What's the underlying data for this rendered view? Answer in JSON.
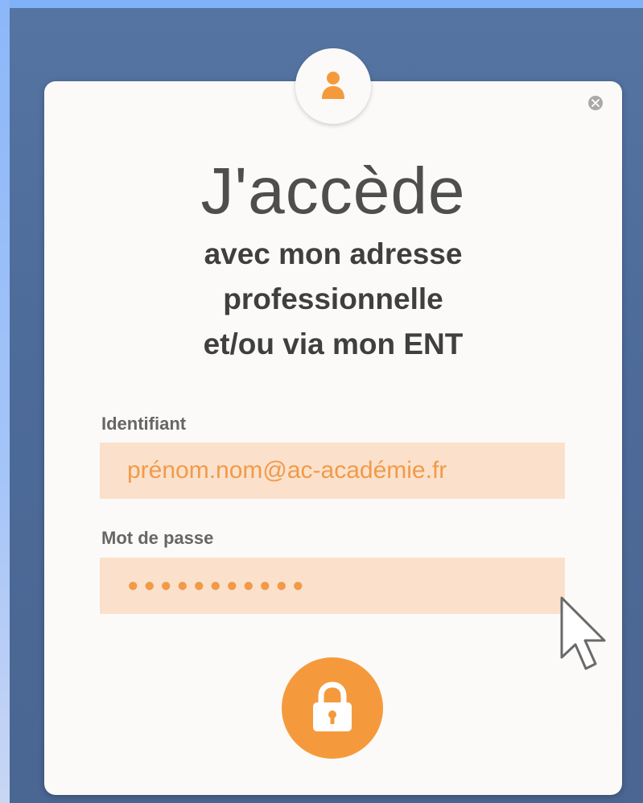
{
  "colors": {
    "accent": "#f59a3c",
    "input_background": "#fbe1cb",
    "input_text": "#f19a4a",
    "card_background": "#fbfaf8",
    "backdrop": "#4d6b99"
  },
  "icons": {
    "avatar": "user-icon",
    "close": "close-icon",
    "submit": "lock-icon",
    "pointer": "mouse-cursor-icon"
  },
  "login": {
    "title": "J'accède",
    "subtitle_lines": [
      "avec mon adresse",
      "professionnelle",
      "et/ou via mon ENT"
    ],
    "username": {
      "label": "Identifiant",
      "placeholder": "prénom.nom@ac-académie.fr"
    },
    "password": {
      "label": "Mot de passe",
      "masked_value": "●●●●●●●●●●●"
    }
  }
}
